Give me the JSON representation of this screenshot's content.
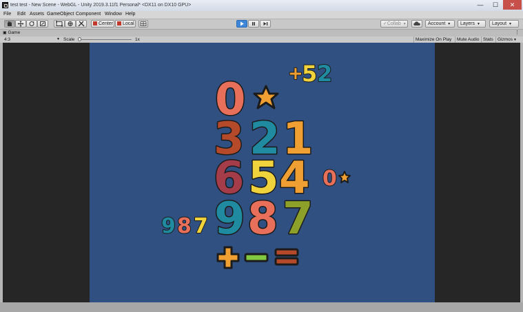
{
  "window": {
    "title": "test test - New Scene - WebGL - Unity 2019.3.11f1 Personal* <DX11 on DX10 GPU>",
    "min_glyph": "—",
    "max_glyph": "☐",
    "close_glyph": "✕"
  },
  "menu": [
    "File",
    "Edit",
    "Assets",
    "GameObject",
    "Component",
    "Window",
    "Help"
  ],
  "toolbar": {
    "center_label": "Center",
    "local_label": "Local",
    "collab_label": "Collab",
    "account_label": "Account",
    "layers_label": "Layers",
    "layout_label": "Layout"
  },
  "tab": {
    "label": "Game"
  },
  "game_toolbar": {
    "aspect": "4:3",
    "scale_label": "Scale",
    "scale_value": "1x",
    "maximize_label": "Maximize On Play",
    "mute_label": "Mute Audio",
    "stats_label": "Stats",
    "gizmos_label": "Gizmos"
  },
  "game": {
    "colors": {
      "background": "#305081",
      "orange": "#f0a032",
      "coral": "#e8705a",
      "teal": "#1f8aa0",
      "yellow": "#f0d23c",
      "green": "#82c841",
      "rust": "#b44a2a",
      "crimson": "#a53c4a",
      "olive": "#8ca02a",
      "outline": "#1b1b1b"
    },
    "glyphs": {
      "top_plus": "+",
      "top_5": "5",
      "top_2": "2",
      "zero": "0",
      "row2_3": "3",
      "row2_2": "2",
      "row2_1": "1",
      "row3_6": "6",
      "row3_5": "5",
      "row3_4": "4",
      "small_zero": "0",
      "row4_9": "9",
      "row4_8": "8",
      "row4_7": "7",
      "small_9": "9",
      "small_8": "8",
      "small_7": "7"
    }
  }
}
